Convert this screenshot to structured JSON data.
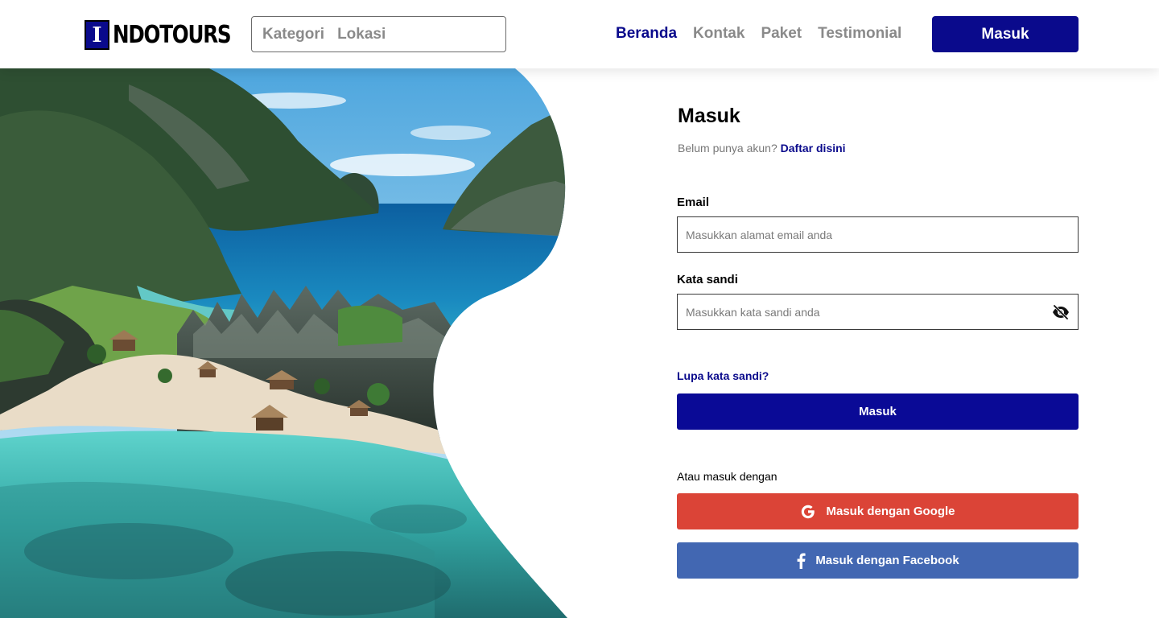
{
  "header": {
    "logo_letter": "I",
    "logo_text": "NDOTOURS",
    "search": {
      "category_label": "Kategori",
      "location_placeholder": "Lokasi"
    },
    "nav": [
      "Beranda",
      "Kontak",
      "Paket",
      "Testimonial"
    ],
    "active_nav": "Beranda",
    "login_button": "Masuk"
  },
  "form": {
    "title": "Masuk",
    "no_account_text": "Belum punya akun?",
    "register_link": "Daftar disini",
    "email_label": "Email",
    "email_placeholder": "Masukkan alamat email anda",
    "password_label": "Kata sandi",
    "password_placeholder": "Masukkan kata sandi anda",
    "forgot_link": "Lupa kata sandi?",
    "submit_label": "Masuk",
    "alt_login_text": "Atau masuk dengan",
    "google_button": "Masuk dengan Google",
    "facebook_button": "Masuk dengan Facebook"
  },
  "colors": {
    "brand": "#0a0a8c",
    "google": "#db4437",
    "facebook": "#4267b2",
    "muted": "#8a8a8a"
  },
  "icons": {
    "search_button": "search-icon",
    "password_toggle": "eye-slash-icon",
    "google": "google-icon",
    "facebook": "facebook-icon"
  }
}
